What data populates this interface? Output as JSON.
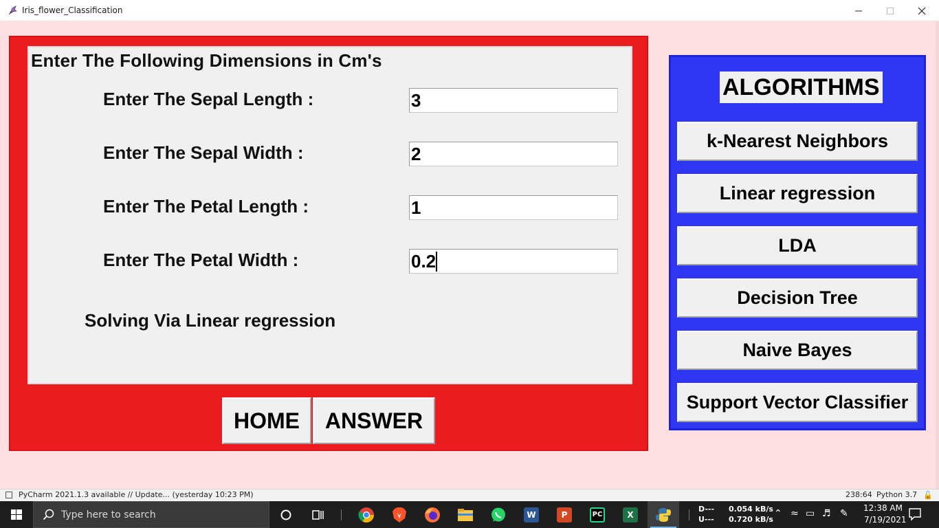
{
  "window": {
    "title": "Iris_flower_Classification",
    "icon": "python-feather-icon",
    "controls": [
      "minimize-icon",
      "maximize-icon",
      "close-icon"
    ]
  },
  "form": {
    "heading": "Enter The Following Dimensions in Cm's",
    "fields": [
      {
        "label": "Enter The Sepal Length :",
        "value": "3"
      },
      {
        "label": "Enter The Sepal Width :",
        "value": "2"
      },
      {
        "label": "Enter The Petal Length :",
        "value": "1"
      },
      {
        "label": "Enter The Petal Width :",
        "value": "0.2"
      }
    ],
    "status": "Solving Via Linear regression",
    "buttons": {
      "home": "HOME",
      "answer": "ANSWER"
    }
  },
  "algorithms": {
    "heading": "ALGORITHMS",
    "items": [
      "k-Nearest Neighbors",
      "Linear regression",
      "LDA",
      "Decision Tree",
      "Naive Bayes",
      "Support Vector Classifier"
    ]
  },
  "ide_status": {
    "notice": "PyCharm 2021.1.3 available // Update... (yesterday 10:23 PM)",
    "cursor_position": "238:64",
    "interpreter": "Python 3.7"
  },
  "taskbar": {
    "search_placeholder": "Type here to search",
    "net_down_label": "D---",
    "net_up_label": "U---",
    "net_down_speed": "0.054 kB/s",
    "net_up_speed": "0.720 kB/s",
    "time": "12:38 AM",
    "date": "7/19/2021",
    "apps": [
      "cortana-icon",
      "task-view-icon",
      "chrome-icon",
      "brave-icon",
      "firefox-icon",
      "file-explorer-icon",
      "whatsapp-icon",
      "word-icon",
      "powerpoint-icon",
      "pycharm-icon",
      "excel-icon",
      "python-icon"
    ]
  },
  "colors": {
    "window_bg": "#ffe0e2",
    "red_panel": "#ec1b1f",
    "blue_panel": "#2f37f2",
    "button_face": "#f0f0f0"
  }
}
